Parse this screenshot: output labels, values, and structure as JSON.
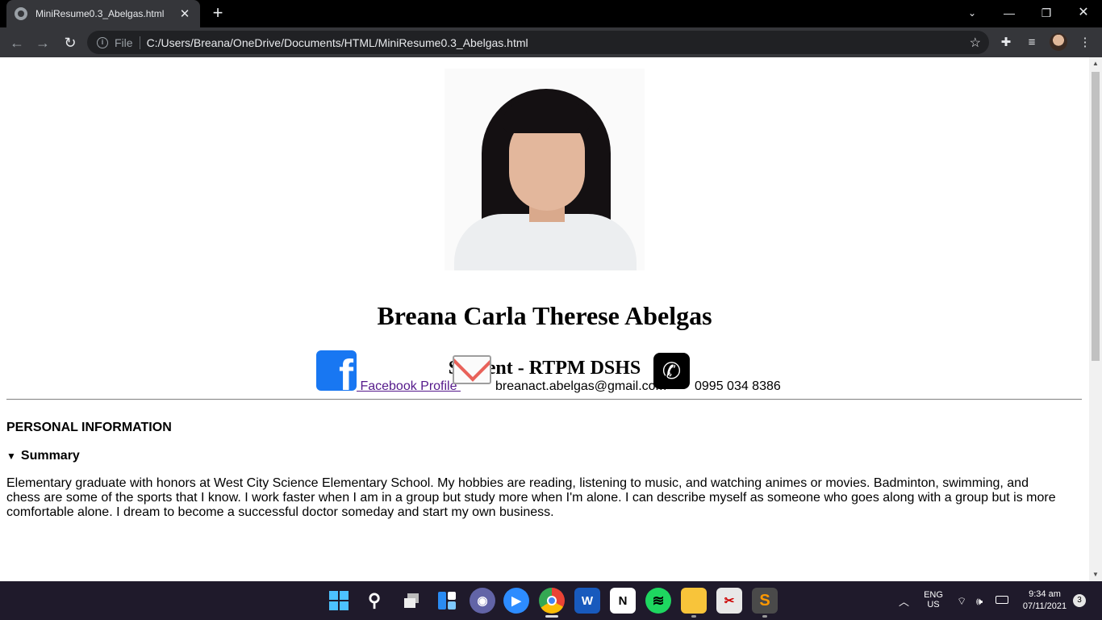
{
  "browser": {
    "tab_title": "MiniResume0.3_Abelgas.html",
    "scheme_label": "File",
    "url": "C:/Users/Breana/OneDrive/Documents/HTML/MiniResume0.3_Abelgas.html"
  },
  "page": {
    "name": "Breana Carla Therese Abelgas",
    "role": "Student - RTPM DSHS",
    "contacts": {
      "facebook_label": " Facebook Profile ",
      "email": "breanact.abelgas@gmail.com",
      "phone": "0995 034 8386"
    },
    "section_title": "PERSONAL INFORMATION",
    "summary_label": "Summary",
    "summary_text": "Elementary graduate with honors at West City Science Elementary School. My hobbies are reading, listening to music, and watching animes or movies. Badminton, swimming, and chess are some of the sports that I know. I work faster when I am in a group but study more when I'm alone. I can describe myself as someone who goes along with a group but is more comfortable alone. I dream to become a successful doctor someday and start my own business."
  },
  "taskbar": {
    "lang_top": "ENG",
    "lang_bottom": "US",
    "time": "9:34 am",
    "date": "07/11/2021",
    "notifications": "3"
  },
  "colors": {
    "facebook": "#1877f2",
    "link_visited": "#551a8b",
    "chrome_dark": "#35363a"
  }
}
